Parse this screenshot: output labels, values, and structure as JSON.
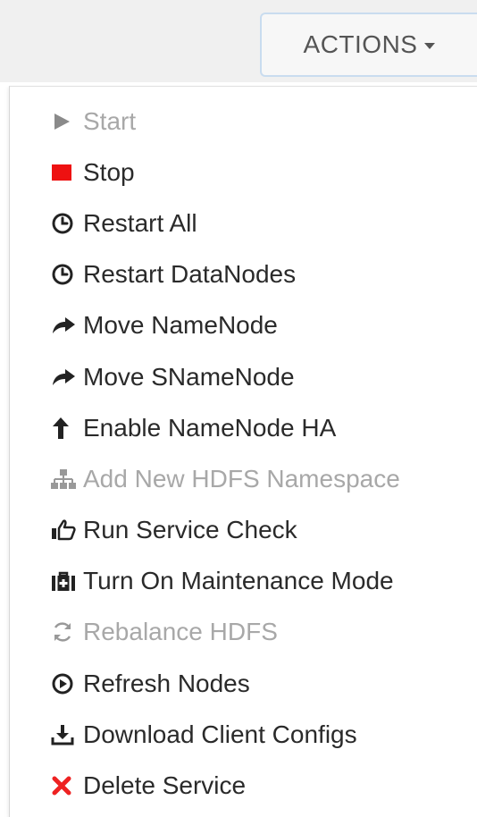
{
  "header": {
    "actions_label": "ACTIONS"
  },
  "menu": {
    "items": [
      {
        "label": "Start",
        "icon": "play-icon",
        "disabled": true
      },
      {
        "label": "Stop",
        "icon": "stop-icon",
        "disabled": false
      },
      {
        "label": "Restart All",
        "icon": "clock-icon",
        "disabled": false
      },
      {
        "label": "Restart DataNodes",
        "icon": "clock-icon",
        "disabled": false
      },
      {
        "label": "Move NameNode",
        "icon": "share-arrow-icon",
        "disabled": false
      },
      {
        "label": "Move SNameNode",
        "icon": "share-arrow-icon",
        "disabled": false
      },
      {
        "label": "Enable NameNode HA",
        "icon": "arrow-up-icon",
        "disabled": false
      },
      {
        "label": "Add New HDFS Namespace",
        "icon": "sitemap-icon",
        "disabled": true
      },
      {
        "label": "Run Service Check",
        "icon": "thumbs-up-icon",
        "disabled": false
      },
      {
        "label": "Turn On Maintenance Mode",
        "icon": "medkit-icon",
        "disabled": false
      },
      {
        "label": "Rebalance HDFS",
        "icon": "refresh-icon",
        "disabled": true
      },
      {
        "label": "Refresh Nodes",
        "icon": "play-circle-icon",
        "disabled": false
      },
      {
        "label": "Download Client Configs",
        "icon": "download-icon",
        "disabled": false
      },
      {
        "label": "Delete Service",
        "icon": "close-icon",
        "disabled": false
      }
    ]
  },
  "colors": {
    "stop": "#ee1111",
    "delete": "#ee2222",
    "disabled_text": "#a8a8a8",
    "text": "#2a2a2a"
  }
}
